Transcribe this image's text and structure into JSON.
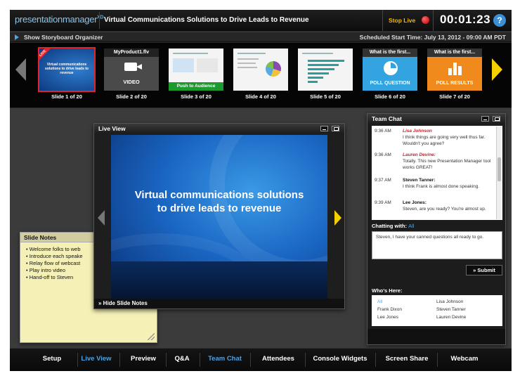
{
  "app": {
    "brand": "presentationmanager",
    "brand_sup": "XD",
    "presentation_title": "Virtual Communications Solutions to Drive Leads to Revenue",
    "stop_live": "Stop Live",
    "timer": "00:01:23",
    "help": "?"
  },
  "infobar": {
    "toggle_label": "Show Storyboard Organizer",
    "scheduled": "Scheduled Start Time: July 13, 2012 - 09:00 AM PDT"
  },
  "storyboard": {
    "slides": [
      {
        "caption": "Slide 1 of 20",
        "badge": "LIVE",
        "thumb_text": "Virtual communications solutions to drive leads to revenue"
      },
      {
        "caption": "Slide 2 of 20",
        "header": "MyProduct1.flv",
        "footer": "VIDEO"
      },
      {
        "caption": "Slide 3 of 20",
        "footer": "Push to Audience"
      },
      {
        "caption": "Slide 4 of 20"
      },
      {
        "caption": "Slide 5 of 20"
      },
      {
        "caption": "Slide 6 of 20",
        "header": "What is the first...",
        "footer": "POLL QUESTION"
      },
      {
        "caption": "Slide 7 of 20",
        "header": "What is the first...",
        "footer": "POLL RESULTS"
      }
    ]
  },
  "notes": {
    "title": "Slide Notes",
    "items": [
      "Welcome folks to web",
      "Introduce each speake",
      "Relay flow of webcast",
      "Play intro video",
      "Hand-off to Steven"
    ]
  },
  "liveview": {
    "title": "Live View",
    "headline_1": "Virtual communications solutions",
    "headline_2": "to drive leads to revenue",
    "hide_notes": "» Hide Slide Notes"
  },
  "chat": {
    "title": "Team Chat",
    "messages": [
      {
        "time": "9:36 AM",
        "name": "Lisa Johnson",
        "text": "I think things are going very well thus far. Wouldn't you agree?"
      },
      {
        "time": "9:36 AM",
        "name": "Lauren Devine:",
        "text": "Totally. This new Presentation Manager tool works GREAT!"
      },
      {
        "time": "9:37 AM",
        "name": "Steven Tanner:",
        "text": "I think Frank is almost done speaking."
      },
      {
        "time": "9:39 AM",
        "name": "Lee Jones:",
        "text": "Steven, are you ready? You're almost up."
      }
    ],
    "chatting_with_label": "Chatting with:",
    "chatting_with_value": "All",
    "input_value": "Steven, I have your canned questions all ready to go.",
    "submit": "» Submit",
    "whos_here_label": "Who's Here:",
    "people": [
      "All",
      "Lisa Johnson",
      "Frank Dixon",
      "Steven Tanner",
      "Lee Jones",
      "Lauren Devine"
    ]
  },
  "tabs": [
    "Setup",
    "Live View",
    "Preview",
    "Q&A",
    "Team Chat",
    "Attendees",
    "Console Widgets",
    "Screen Share",
    "Webcam"
  ],
  "colors": {
    "accent": "#4ea3e0",
    "live_red": "#e0242c",
    "stop_live": "#f6b800",
    "arrow_yellow": "#f4d000"
  }
}
